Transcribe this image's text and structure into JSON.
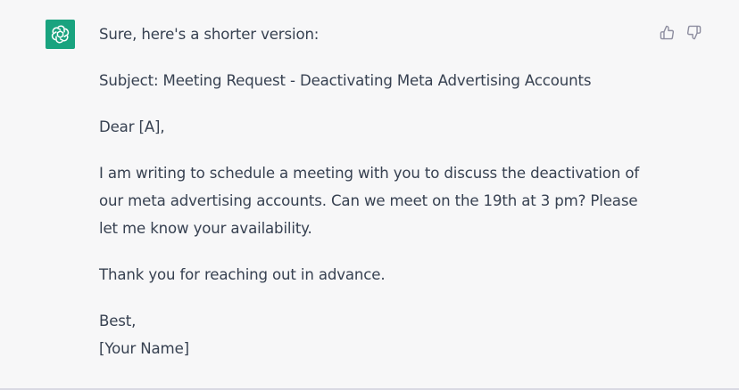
{
  "message": {
    "role": "assistant",
    "avatar_icon": "openai-logo-icon",
    "avatar_color": "#19a37f",
    "intro": "Sure, here's a shorter version:",
    "subject": "Subject: Meeting Request - Deactivating Meta Advertising Accounts",
    "greeting": "Dear [A],",
    "body_lines": [
      "I am writing to schedule a meeting with you to discuss the deactivation of",
      "our meta advertising accounts. Can we meet on the 19th at 3 pm? Please",
      "let me know your availability."
    ],
    "thanks": "Thank you for reaching out in advance.",
    "signoff": "Best,",
    "signature": "[Your Name]"
  },
  "actions": {
    "thumbs_up_icon": "thumbs-up-icon",
    "thumbs_down_icon": "thumbs-down-icon"
  }
}
